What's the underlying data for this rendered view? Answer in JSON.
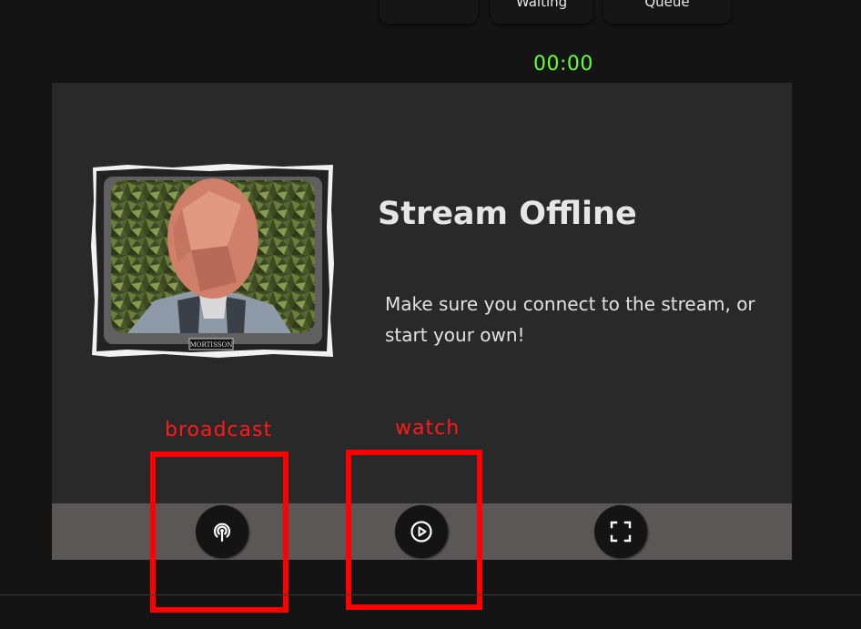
{
  "nav": {
    "buttons": [
      {
        "label": ""
      },
      {
        "label": "Waiting"
      },
      {
        "label": "Queue"
      }
    ]
  },
  "timer": "00:00",
  "stream": {
    "title": "Stream Offline",
    "message": "Make sure you connect to the stream, or start your own!",
    "thumbnail_caption": "MORTISSON"
  },
  "controls": [
    {
      "icon": "broadcast-icon"
    },
    {
      "icon": "play-icon"
    },
    {
      "icon": "fullscreen-icon"
    }
  ],
  "annotations": {
    "broadcast": "broadcast",
    "watch": "watch"
  },
  "colors": {
    "timer": "#66ff33",
    "annotation": "#ff0000",
    "panel": "#2a2929",
    "control_bar": "#5b5757"
  }
}
